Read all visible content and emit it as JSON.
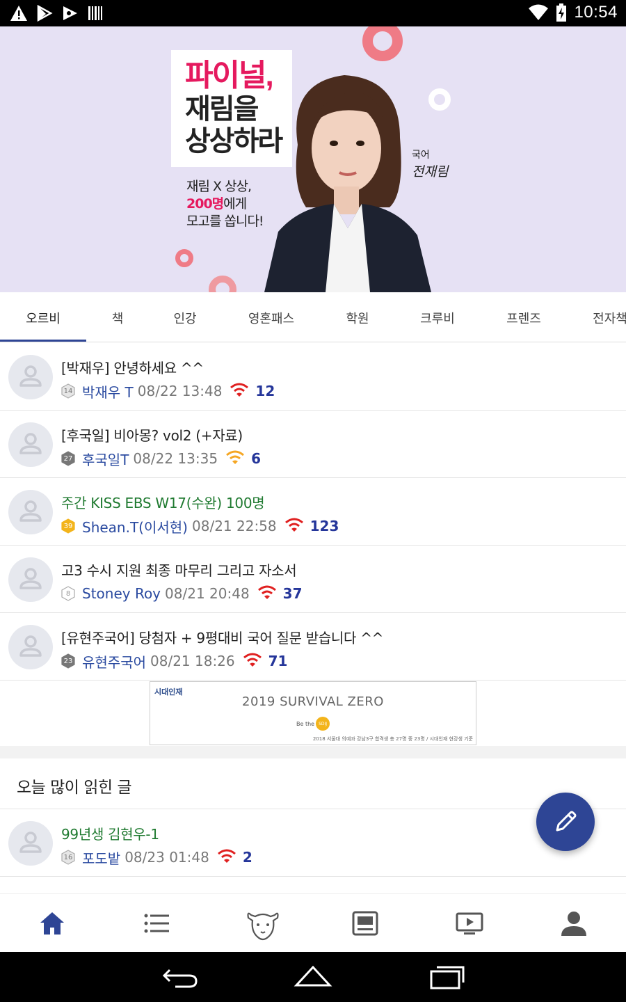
{
  "status_bar": {
    "time": "10:54",
    "icons": [
      "warning-icon",
      "play-store-icon",
      "play-movies-icon",
      "barcode-icon",
      "wifi-icon",
      "battery-charging-icon"
    ]
  },
  "banner": {
    "headline_1": "파이널,",
    "headline_2": "재림을",
    "headline_3": "상상하라",
    "promo_1": "재림 X 상상,",
    "promo_2_highlight": "200명",
    "promo_2_rest": "에게",
    "promo_3": "모고를 쏩니다!",
    "subject": "국어",
    "teacher_signature": "전재림",
    "accent_color": "#e5195e",
    "background_color": "#e6e1f4"
  },
  "tabs": [
    {
      "label": "오르비",
      "active": true
    },
    {
      "label": "책"
    },
    {
      "label": "인강"
    },
    {
      "label": "영혼패스"
    },
    {
      "label": "학원"
    },
    {
      "label": "크루비"
    },
    {
      "label": "프렌즈"
    },
    {
      "label": "전자책"
    }
  ],
  "posts": [
    {
      "title": "[박재우] 안녕하세요 ^^",
      "level": "14",
      "author": "박재우 T",
      "date": "08/22 13:48",
      "count": "12",
      "title_color": "default",
      "signal_color": "#e02020"
    },
    {
      "title": "[후국일] 비아몽? vol2 (+자료)",
      "level": "27",
      "author": "후국일T",
      "date": "08/22 13:35",
      "count": "6",
      "title_color": "default",
      "signal_color": "#f5a623"
    },
    {
      "title": "주간 KISS EBS W17(수완) 100명",
      "level": "39",
      "author": "Shean.T(이서현)",
      "date": "08/21 22:58",
      "count": "123",
      "title_color": "green",
      "signal_color": "#e02020"
    },
    {
      "title": "고3 수시 지원 최종 마무리 그리고 자소서",
      "level": "8",
      "author": "Stoney Roy",
      "date": "08/21 20:48",
      "count": "37",
      "title_color": "default",
      "signal_color": "#e02020"
    },
    {
      "title": "[유현주국어] 당첨자 + 9평대비 국어 질문 받습니다 ^^",
      "level": "23",
      "author": "유현주국어",
      "date": "08/21 18:26",
      "count": "71",
      "title_color": "default",
      "signal_color": "#e02020"
    }
  ],
  "ad": {
    "logo": "시대인재",
    "title": "2019 SURVIVAL ZERO",
    "tagline_prefix": "Be the",
    "tagline_badge": "SDIJ",
    "footnote": "2018 서울대 의예과 강남3구 합격생 총 27명 중 23명 / 시대인재 현강생 기준"
  },
  "popular_section": {
    "title": "오늘 많이 읽힌 글",
    "posts": [
      {
        "title": "99년생 김현우-1",
        "level": "16",
        "author": "포도밭",
        "date": "08/23 01:48",
        "count": "2",
        "title_color": "green",
        "signal_color": "#e02020"
      }
    ]
  },
  "fab": {
    "icon": "pencil-icon"
  },
  "bottom_nav": [
    {
      "name": "home-icon",
      "active": true
    },
    {
      "name": "list-icon"
    },
    {
      "name": "goat-mascot-icon"
    },
    {
      "name": "monitor-icon"
    },
    {
      "name": "video-lecture-icon"
    },
    {
      "name": "profile-icon"
    }
  ],
  "system_nav": [
    "back-icon",
    "home-button-icon",
    "recents-icon"
  ],
  "colors": {
    "primary": "#2e4595",
    "green_title": "#1f7a30",
    "author_blue": "#2a4aa0"
  }
}
